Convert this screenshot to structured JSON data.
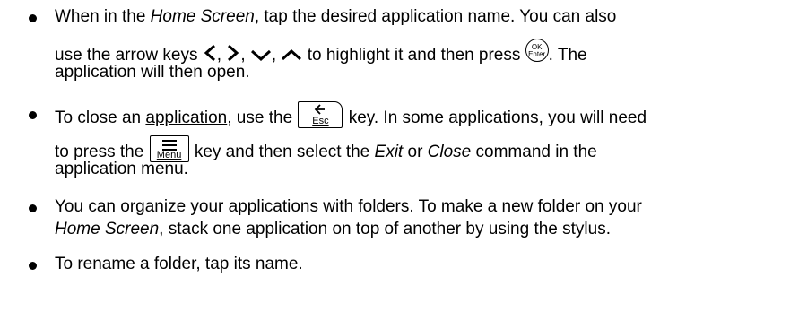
{
  "items": [
    {
      "line1": {
        "t1": "When in the ",
        "i1": "Home Screen",
        "t2": ", tap the desired application name. You can also"
      },
      "line2": {
        "t1": "use the arrow keys ",
        "sep1": ",",
        "sep2": ",",
        "sep3": ",",
        "t2": " to highlight it and then press ",
        "t3": ". The"
      },
      "line3": "application will then open.",
      "ok_key": {
        "top": "OK",
        "bottom": "Enter"
      }
    },
    {
      "line1": {
        "t1": "To close an ",
        "u1": "application",
        "t2": ", use the ",
        "t3": " key. In some applications, you will need"
      },
      "line2": {
        "t1": "to press the ",
        "t2": " key and then select the ",
        "i1": "Exit",
        "t3": " or ",
        "i2": "Close",
        "t4": " command in the"
      },
      "line3": "application menu.",
      "esc_key": "Esc",
      "menu_key": "Menu"
    },
    {
      "line1": "You can organize your applications with folders. To make a new folder on your",
      "line2": {
        "i1": "Home Screen",
        "t1": ", stack one application on top of another by using the stylus."
      }
    },
    {
      "line1": "To rename a folder, tap its name."
    }
  ]
}
